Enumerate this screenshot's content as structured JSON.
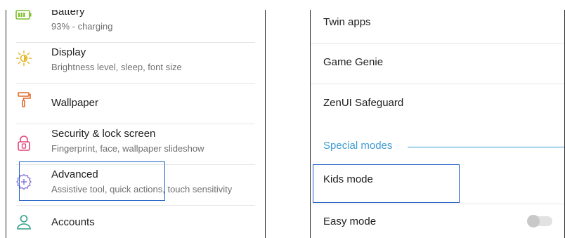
{
  "settings_list": {
    "battery": {
      "title": "Battery",
      "subtitle": "93% - charging",
      "icon": "battery-icon",
      "color": "#7bbf2a"
    },
    "display": {
      "title": "Display",
      "subtitle": "Brightness level, sleep, font size",
      "icon": "brightness-icon",
      "color": "#e5b62a"
    },
    "wallpaper": {
      "title": "Wallpaper",
      "icon": "paint-roller-icon",
      "color": "#e06a2e"
    },
    "security": {
      "title": "Security & lock screen",
      "subtitle": "Fingerprint, face, wallpaper slideshow",
      "icon": "lock-icon",
      "color": "#e0457a"
    },
    "advanced": {
      "title": "Advanced",
      "subtitle": "Assistive tool, quick actions, touch sensitivity",
      "icon": "gear-plus-icon",
      "color": "#8a78d8"
    },
    "accounts": {
      "title": "Accounts",
      "icon": "person-icon",
      "color": "#2e9e86"
    }
  },
  "advanced_list": {
    "twin_apps": "Twin apps",
    "game_genie": "Game Genie",
    "zenui_safeguard": "ZenUI Safeguard",
    "special_modes_header": "Special modes",
    "kids_mode": "Kids mode",
    "easy_mode": {
      "label": "Easy mode",
      "enabled": false
    }
  },
  "colors": {
    "accent": "#3d9bd5",
    "highlight": "#1f5ec4"
  }
}
